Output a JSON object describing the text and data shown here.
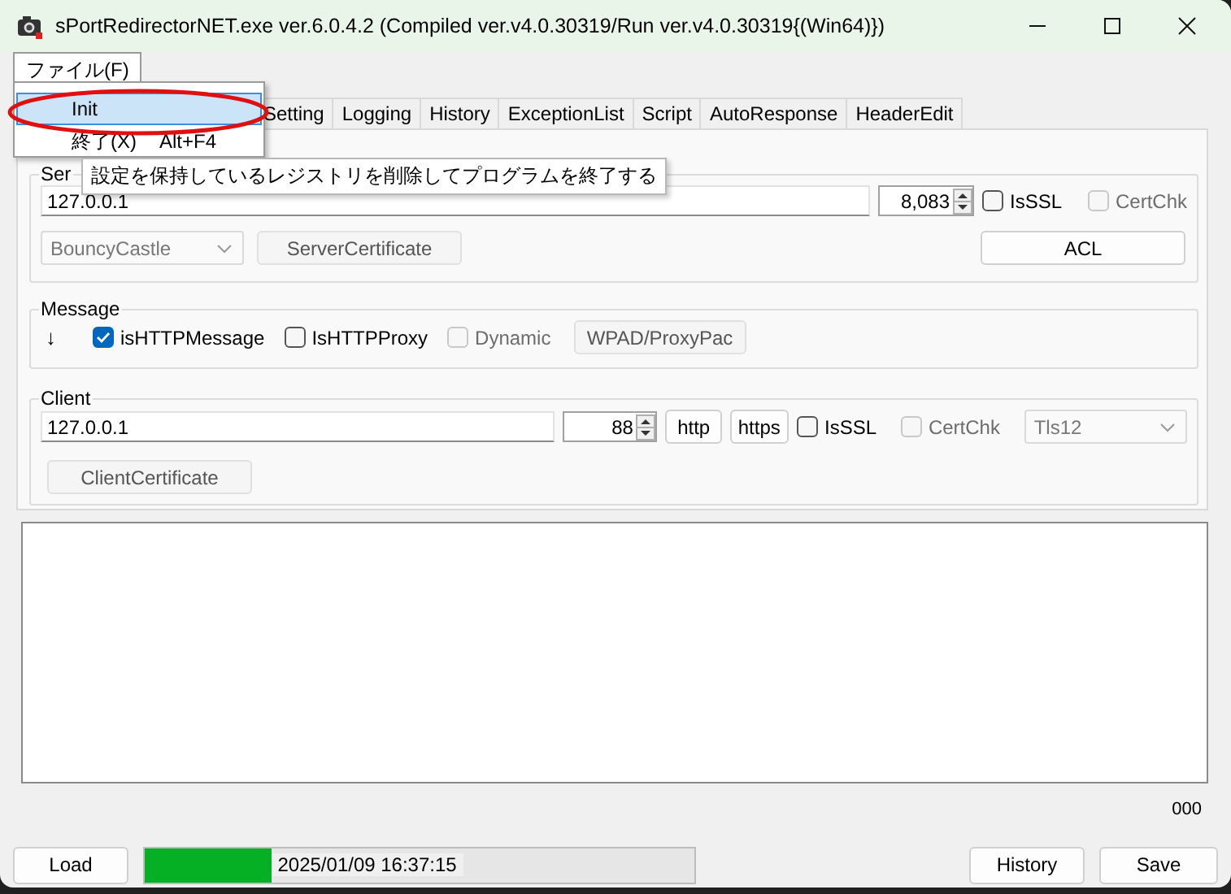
{
  "window": {
    "title": "sPortRedirectorNET.exe ver.6.0.4.2 (Compiled ver.v4.0.30319/Run ver.v4.0.30319{(Win64)})"
  },
  "menu_bar": [
    {
      "label": "ファイル(F)",
      "selected": true
    }
  ],
  "file_menu": [
    {
      "label": "Init",
      "selected": true
    },
    {
      "label": "終了(X)",
      "shortcut": "Alt+F4",
      "selected": false
    }
  ],
  "tooltip": "設定を保持しているレジストリを削除してプログラムを終了する",
  "tabs": [
    {
      "label": "Setting",
      "selected": false
    },
    {
      "label": "Logging",
      "selected": false
    },
    {
      "label": "History",
      "selected": false
    },
    {
      "label": "ExceptionList",
      "selected": false
    },
    {
      "label": "Script",
      "selected": false
    },
    {
      "label": "AutoResponse",
      "selected": false
    },
    {
      "label": "HeaderEdit",
      "selected": false
    }
  ],
  "server": {
    "label": "Ser",
    "address": "127.0.0.1",
    "port": "8,083",
    "is_ssl": {
      "label": "IsSSL",
      "checked": false,
      "disabled": false
    },
    "cert_chk": {
      "label": "CertChk",
      "checked": false,
      "disabled": true
    },
    "provider": {
      "value": "BouncyCastle",
      "disabled": true
    },
    "certificate_button": {
      "label": "ServerCertificate",
      "disabled": true
    },
    "acl_button": "ACL"
  },
  "message": {
    "label": "Message",
    "direction": "↓",
    "options": [
      {
        "label": "isHTTPMessage",
        "checked": true,
        "disabled": false
      },
      {
        "label": "IsHTTPProxy",
        "checked": false,
        "disabled": false
      },
      {
        "label": "Dynamic",
        "checked": false,
        "disabled": true
      }
    ],
    "wpad_button": {
      "label": "WPAD/ProxyPac",
      "disabled": true
    }
  },
  "client": {
    "label": "Client",
    "address": "127.0.0.1",
    "port": "88",
    "http_button": "http",
    "https_button": "https",
    "is_ssl": {
      "label": "IsSSL",
      "checked": false,
      "disabled": false
    },
    "cert_chk": {
      "label": "CertChk",
      "checked": false,
      "disabled": true
    },
    "tls": {
      "value": "Tls12",
      "disabled": true
    },
    "certificate_button": {
      "label": "ClientCertificate",
      "disabled": true
    }
  },
  "log": {
    "count": "000"
  },
  "status": {
    "load_button": "Load",
    "progress": {
      "level": 0.23,
      "text": "2025/01/09 16:37:15"
    },
    "history_button": "History",
    "save_button": "Save"
  }
}
